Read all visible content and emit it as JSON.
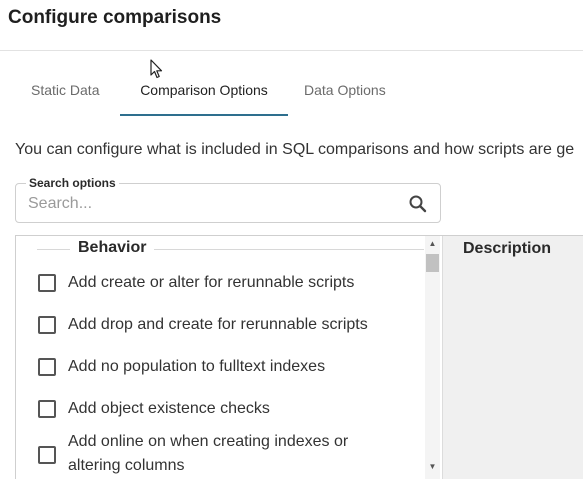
{
  "dialog": {
    "title": "Configure comparisons"
  },
  "tabs": [
    {
      "label": "Static Data",
      "active": false
    },
    {
      "label": "Comparison Options",
      "active": true
    },
    {
      "label": "Data Options",
      "active": false
    }
  ],
  "intro_text": "You can configure what is included in SQL comparisons and how scripts are ge",
  "search": {
    "label": "Search options",
    "placeholder": "Search...",
    "value": ""
  },
  "options_group": {
    "title": "Behavior",
    "items": [
      {
        "label": "Add create or alter for rerunnable scripts",
        "checked": false
      },
      {
        "label": "Add drop and create for rerunnable scripts",
        "checked": false
      },
      {
        "label": "Add no population to fulltext indexes",
        "checked": false
      },
      {
        "label": "Add object existence checks",
        "checked": false
      },
      {
        "label": "Add online on when creating indexes or altering columns",
        "checked": false
      }
    ]
  },
  "description_panel": {
    "title": "Description"
  },
  "colors": {
    "accent": "#2e6f8e",
    "panel_bg": "#f0f0f0",
    "border": "#cfcfcf"
  }
}
